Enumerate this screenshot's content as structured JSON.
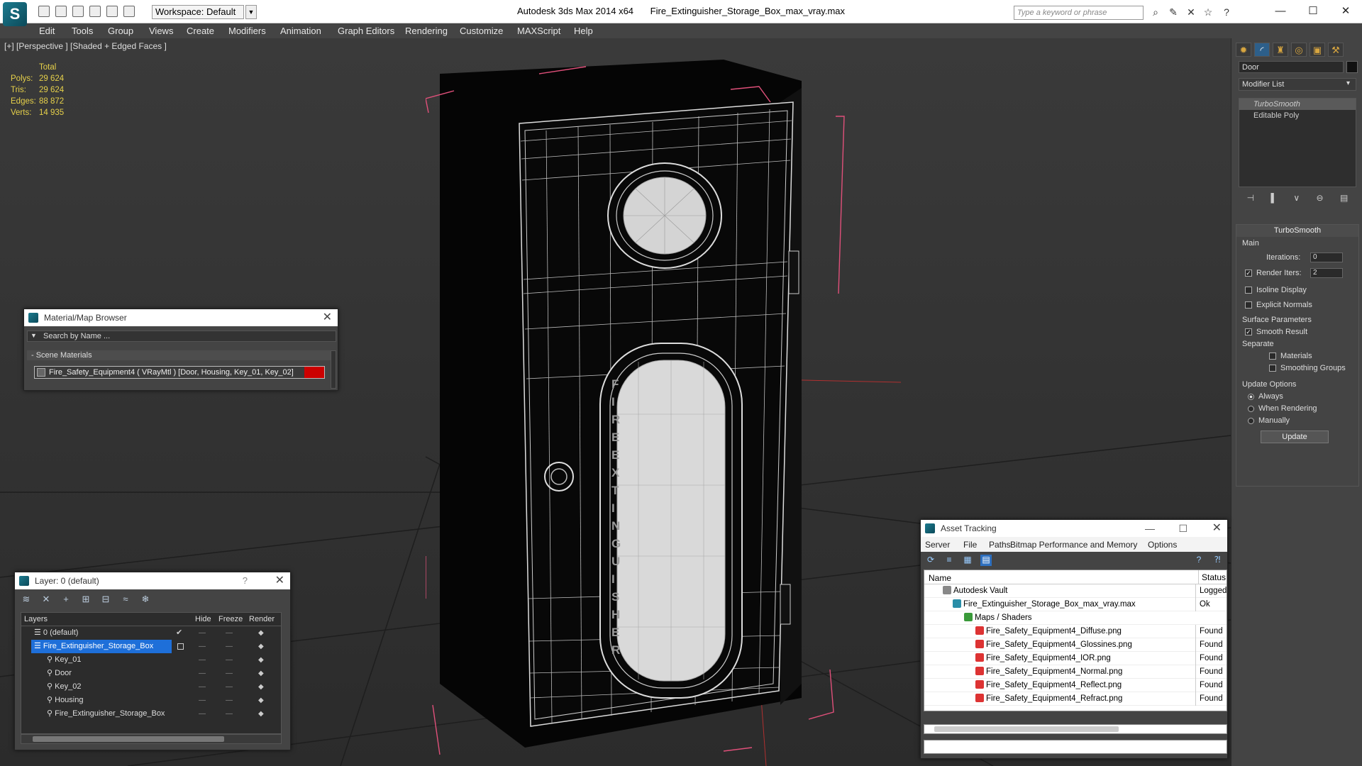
{
  "app": {
    "logo": "S",
    "workspace": "Workspace: Default",
    "title_app": "Autodesk 3ds Max  2014 x64",
    "title_file": "Fire_Extinguisher_Storage_Box_max_vray.max",
    "search_placeholder": "Type a keyword or phrase"
  },
  "menu": [
    "Edit",
    "Tools",
    "Group",
    "Views",
    "Create",
    "Modifiers",
    "Animation",
    "Graph Editors",
    "Rendering",
    "Customize",
    "MAXScript",
    "Help"
  ],
  "viewport": {
    "label": "[+] [Perspective ] [Shaded + Edged Faces ]",
    "stats_total": "Total",
    "stats": [
      {
        "label": "Polys:",
        "value": "29 624"
      },
      {
        "label": "Tris:",
        "value": "29 624"
      },
      {
        "label": "Edges:",
        "value": "88 872"
      },
      {
        "label": "Verts:",
        "value": "14 935"
      }
    ],
    "door_text": "FIRE EXTINGUISHER"
  },
  "command_panel": {
    "object_name": "Door",
    "modifier_list": "Modifier List",
    "stack": [
      "TurboSmooth",
      "Editable Poly"
    ],
    "rollout_title": "TurboSmooth",
    "main_label": "Main",
    "iterations_label": "Iterations:",
    "iterations_value": "0",
    "render_iters_label": "Render Iters:",
    "render_iters_value": "2",
    "isoline": "Isoline Display",
    "explicit": "Explicit Normals",
    "surface_label": "Surface Parameters",
    "smooth_result": "Smooth Result",
    "separate_label": "Separate",
    "materials": "Materials",
    "smoothing_groups": "Smoothing Groups",
    "update_label": "Update Options",
    "always": "Always",
    "when_rendering": "When Rendering",
    "manually": "Manually",
    "update_button": "Update"
  },
  "material_browser": {
    "title": "Material/Map Browser",
    "search_placeholder": "Search by Name ...",
    "section": "- Scene Materials",
    "item": "Fire_Safety_Equipment4  ( VRayMtl )  [Door, Housing, Key_01, Key_02]"
  },
  "layer_manager": {
    "title": "Layer: 0 (default)",
    "help": "?",
    "col_layers": "Layers",
    "col_hide": "Hide",
    "col_freeze": "Freeze",
    "col_render": "Render",
    "rows": [
      {
        "name": "0 (default)",
        "indent": 1,
        "selected": false,
        "check": true
      },
      {
        "name": "Fire_Extinguisher_Storage_Box",
        "indent": 1,
        "selected": true,
        "check": false
      },
      {
        "name": "Key_01",
        "indent": 2,
        "selected": false,
        "check": false
      },
      {
        "name": "Door",
        "indent": 2,
        "selected": false,
        "check": false
      },
      {
        "name": "Key_02",
        "indent": 2,
        "selected": false,
        "check": false
      },
      {
        "name": "Housing",
        "indent": 2,
        "selected": false,
        "check": false
      },
      {
        "name": "Fire_Extinguisher_Storage_Box",
        "indent": 2,
        "selected": false,
        "check": false
      }
    ],
    "dash": "—"
  },
  "asset_tracking": {
    "title": "Asset Tracking",
    "menu": [
      "Server",
      "File",
      "Paths",
      "Bitmap Performance and Memory",
      "Options"
    ],
    "col_name": "Name",
    "col_status": "Status",
    "rows": [
      {
        "name": "Autodesk Vault",
        "status": "Logged",
        "indent": 1,
        "icon": "vault"
      },
      {
        "name": "Fire_Extinguisher_Storage_Box_max_vray.max",
        "status": "Ok",
        "indent": 2,
        "icon": "max"
      },
      {
        "name": "Maps / Shaders",
        "status": "",
        "indent": 3,
        "icon": "maps"
      },
      {
        "name": "Fire_Safety_Equipment4_Diffuse.png",
        "status": "Found",
        "indent": 4,
        "icon": "png"
      },
      {
        "name": "Fire_Safety_Equipment4_Glossines.png",
        "status": "Found",
        "indent": 4,
        "icon": "png"
      },
      {
        "name": "Fire_Safety_Equipment4_IOR.png",
        "status": "Found",
        "indent": 4,
        "icon": "png"
      },
      {
        "name": "Fire_Safety_Equipment4_Normal.png",
        "status": "Found",
        "indent": 4,
        "icon": "png"
      },
      {
        "name": "Fire_Safety_Equipment4_Reflect.png",
        "status": "Found",
        "indent": 4,
        "icon": "png"
      },
      {
        "name": "Fire_Safety_Equipment4_Refract.png",
        "status": "Found",
        "indent": 4,
        "icon": "png"
      }
    ]
  },
  "colors": {
    "accent": "#1e6fd9",
    "bbox": "#e0507a",
    "stats": "#e6d04a",
    "material_swatch": "#cc0000"
  }
}
